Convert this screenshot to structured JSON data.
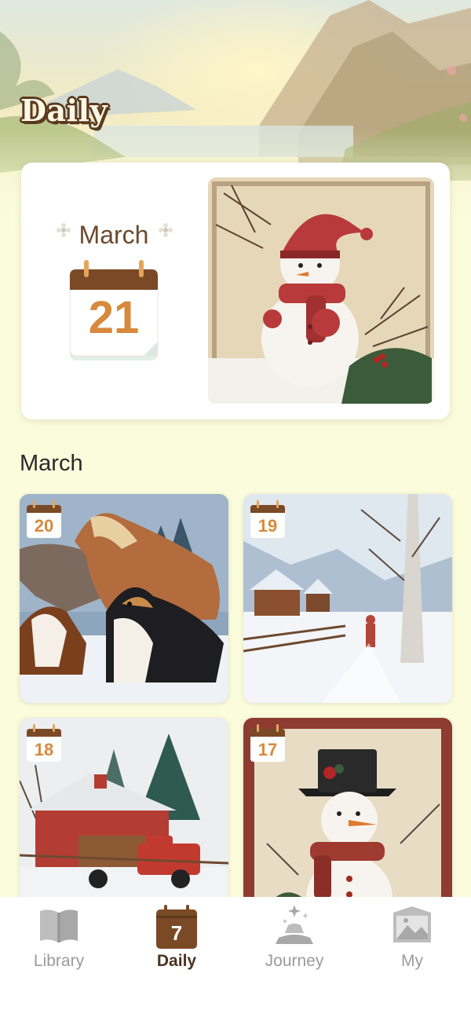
{
  "header": {
    "title": "Daily"
  },
  "today": {
    "month": "March",
    "day": "21",
    "image": "snowman-plaid-hat"
  },
  "section": {
    "title": "March"
  },
  "tiles": [
    {
      "day": "20",
      "image": "horses-and-collies-in-snow"
    },
    {
      "day": "19",
      "image": "winter-village-birch-tree"
    },
    {
      "day": "18",
      "image": "red-barn-and-truck"
    },
    {
      "day": "17",
      "image": "snowman-top-hat"
    }
  ],
  "nav": {
    "items": [
      {
        "label": "Library",
        "icon": "book-icon",
        "active": false
      },
      {
        "label": "Daily",
        "icon": "calendar-icon",
        "active": true,
        "day": "7"
      },
      {
        "label": "Journey",
        "icon": "journey-icon",
        "active": false
      },
      {
        "label": "My",
        "icon": "picture-icon",
        "active": false
      }
    ]
  },
  "colors": {
    "accent": "#d8893c",
    "brown": "#6b4a2e",
    "background": "#fbfcdc"
  }
}
